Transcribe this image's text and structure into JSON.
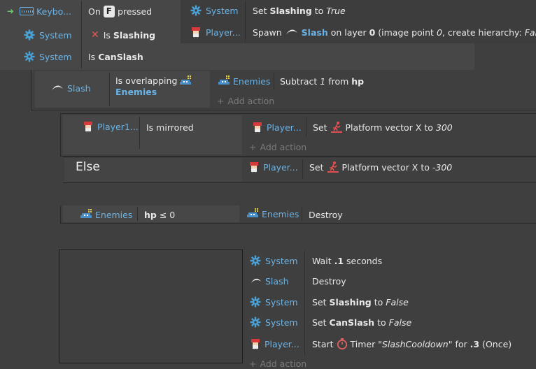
{
  "event1": {
    "conditions": [
      {
        "object": "Keybo...",
        "pre": "On",
        "key": "F",
        "post": "pressed"
      },
      {
        "object": "System",
        "text": "Is",
        "bold": "Slashing"
      },
      {
        "object": "System",
        "text": "Is",
        "bold": "CanSlash"
      }
    ],
    "actions": [
      {
        "object": "System",
        "pre": "Set",
        "bold": "Slashing",
        "mid": "to",
        "val": "True"
      },
      {
        "object": "Player...",
        "pre": "Spawn",
        "bold": "Slash",
        "mid": "on layer",
        "layer": "0",
        "p1": "(image point",
        "imgpt": "0",
        "p2": ", create hierarchy:",
        "hier": "False",
        "p3": ")"
      }
    ]
  },
  "event2": {
    "object": "Slash",
    "cond_line1": "Is overlapping",
    "cond_line2": "Enemies",
    "action_object": "Enemies",
    "action_pre": "Subtract",
    "action_val": "1",
    "action_mid": "from",
    "action_bold": "hp",
    "add_action": "Add action"
  },
  "event3": {
    "object": "Player1...",
    "condition": "Is mirrored",
    "action_object": "Player...",
    "action_pre": "Set",
    "action_text": "Platform vector X to",
    "action_val": "300",
    "add_action": "Add action"
  },
  "else_event": {
    "label": "Else",
    "action_object": "Player...",
    "action_pre": "Set",
    "action_text": "Platform vector X to",
    "action_val": "-300"
  },
  "event4": {
    "object": "Enemies",
    "cond_bold": "hp",
    "cond_rest": "≤ 0",
    "action_object": "Enemies",
    "action_text": "Destroy"
  },
  "event5": {
    "actions": [
      {
        "object": "System",
        "pre": "Wait",
        "bold": ".1",
        "post": "seconds"
      },
      {
        "object": "Slash",
        "pre": "Destroy"
      },
      {
        "object": "System",
        "pre": "Set",
        "bold": "Slashing",
        "mid": "to",
        "val": "False"
      },
      {
        "object": "System",
        "pre": "Set",
        "bold": "CanSlash",
        "mid": "to",
        "val": "False"
      },
      {
        "object": "Player...",
        "pre": "Start",
        "timer": "Timer",
        "name": "\"SlashCooldown\"",
        "for": "for",
        "dur": ".3",
        "once": "(Once)"
      }
    ],
    "add_action": "Add action"
  }
}
